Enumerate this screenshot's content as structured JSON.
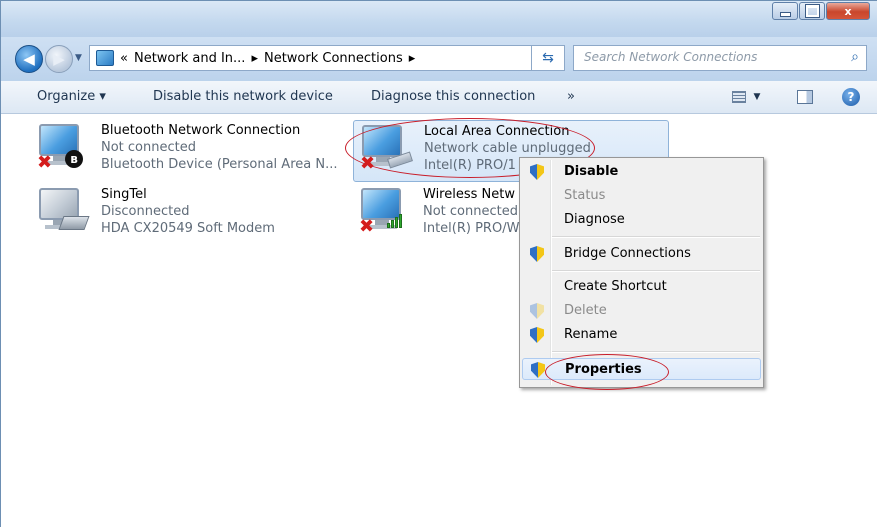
{
  "window": {
    "buttons": {
      "minimize": "minimize",
      "maximize": "maximize",
      "close": "x"
    }
  },
  "nav": {
    "breadcrumb": [
      "«",
      "Network and In...",
      "▸",
      "Network Connections",
      "▸"
    ],
    "search_placeholder": "Search Network Connections"
  },
  "toolbar": {
    "organize": "Organize ▾",
    "disable": "Disable this network device",
    "diagnose": "Diagnose this connection",
    "more": "»"
  },
  "connections": [
    {
      "name": "Bluetooth Network Connection",
      "status": "Not connected",
      "device": "Bluetooth Device (Personal Area N...",
      "icon": "bluetooth-icon"
    },
    {
      "name": "Local Area Connection",
      "status": "Network cable unplugged",
      "device": "Intel(R) PRO/1",
      "icon": "ethernet-icon"
    },
    {
      "name": "SingTel",
      "status": "Disconnected",
      "device": "HDA CX20549 Soft Modem",
      "icon": "modem-icon"
    },
    {
      "name": "Wireless Netw",
      "status": "Not connected",
      "device": "Intel(R) PRO/W",
      "icon": "signal-bars-icon"
    }
  ],
  "context_menu": [
    {
      "label": "Disable"
    },
    {
      "label": "Status"
    },
    {
      "label": "Diagnose"
    },
    {
      "label": "Bridge Connections"
    },
    {
      "label": "Create Shortcut"
    },
    {
      "label": "Delete"
    },
    {
      "label": "Rename"
    },
    {
      "label": "Properties"
    }
  ],
  "colors": {
    "annotation": "#c81e2a",
    "disconnected_x": "#d41c1c",
    "accent": "#2c6bb0"
  }
}
